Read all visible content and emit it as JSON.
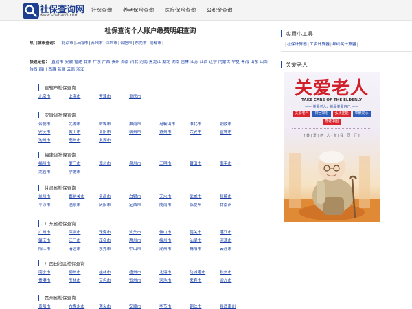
{
  "header": {
    "brand": "社保查询网",
    "url": "www.shebao5.com",
    "nav": [
      "社保查询",
      "养老保险查询",
      "医疗保险查询",
      "公积金查询"
    ]
  },
  "main": {
    "title": "社保查询个人账户缴费明细查询",
    "hot_label": "热门城市查询：",
    "hot_cities": [
      "北京市",
      "上海市",
      "苏州市",
      "深圳市",
      "合肥市",
      "东莞市",
      "成都市"
    ],
    "quick_label": "快速定位：",
    "quick_links": [
      "直辖市",
      "安徽",
      "福建",
      "甘肃",
      "广东",
      "广西",
      "贵州",
      "海南",
      "河北",
      "河南",
      "黑龙江",
      "湖北",
      "湖南",
      "吉林",
      "江苏",
      "江西",
      "辽宁",
      "内蒙古",
      "宁夏",
      "青海",
      "山东",
      "山西",
      "陕西",
      "四川",
      "西藏",
      "新疆",
      "云南",
      "浙江"
    ],
    "provinces": [
      {
        "title": "直辖市社保查询",
        "cities": [
          "北京市",
          "上海市",
          "天津市",
          "重庆市"
        ]
      },
      {
        "title": "安徽省社保查询",
        "cities": [
          "合肥市",
          "芜湖市",
          "蚌埠市",
          "淮南市",
          "马鞍山市",
          "淮北市",
          "铜陵市",
          "安庆市",
          "黄山市",
          "阜阳市",
          "宿州市",
          "滁州市",
          "六安市",
          "宣城市",
          "池州市",
          "亳州市",
          "巢湖市"
        ]
      },
      {
        "title": "福建省社保查询",
        "cities": [
          "福州市",
          "厦门市",
          "漳州市",
          "泉州市",
          "三明市",
          "莆田市",
          "南平市",
          "龙岩市",
          "宁德市"
        ]
      },
      {
        "title": "甘肃省社保查询",
        "cities": [
          "兰州市",
          "嘉峪关市",
          "金昌市",
          "白银市",
          "天水市",
          "武威市",
          "张掖市",
          "平凉市",
          "酒泉市",
          "庆阳市",
          "定西市",
          "陇南市",
          "临夏州",
          "甘南州"
        ]
      },
      {
        "title": "广东省社保查询",
        "cities": [
          "广州市",
          "深圳市",
          "珠海市",
          "汕头市",
          "佛山市",
          "韶关市",
          "湛江市",
          "肇庆市",
          "江门市",
          "茂名市",
          "惠州市",
          "梅州市",
          "汕尾市",
          "河源市",
          "阳江市",
          "清远市",
          "东莞市",
          "中山市",
          "潮州市",
          "揭阳市",
          "云浮市"
        ]
      },
      {
        "title": "广西自治区社保查询",
        "cities": [
          "南宁市",
          "柳州市",
          "桂林市",
          "梧州市",
          "北海市",
          "防城港市",
          "钦州市",
          "贵港市",
          "玉林市",
          "百色市",
          "贺州市",
          "河池市",
          "来宾市",
          "崇左市"
        ]
      },
      {
        "title": "贵州省社保查询",
        "cities": [
          "贵阳市",
          "六盘水市",
          "遵义市",
          "安顺市",
          "毕节市",
          "铜仁市",
          "黔西南州"
        ]
      }
    ]
  },
  "sidebar": {
    "tools_title": "实用小工具",
    "tools": [
      "社保计算器",
      "工资计算器",
      "年终奖计算器"
    ],
    "elder_title": "关爱老人",
    "poster": {
      "title": "关爱老人",
      "en": "TAKE CARE OF THE ELDERLY",
      "sub": "—— 关爱老人，就是关爱自己 ——",
      "chips": [
        {
          "text": "关爱老人",
          "color": "red"
        },
        {
          "text": "常回家看",
          "color": "blue"
        },
        {
          "text": "弘扬正能",
          "color": "red"
        },
        {
          "text": "奉献爱心",
          "color": "blue"
        },
        {
          "text": "尊老中国",
          "color": "red"
        }
      ],
      "small": "[ 关 | 爱 | 老 | 人 · 你 | 我 | 同 | 行 ]"
    }
  },
  "colors": {
    "brand": "#1e3f8f",
    "link": "#1a3fa6",
    "accent_red": "#d2202a"
  },
  "icons": {
    "logo": "magnifier-icon"
  }
}
